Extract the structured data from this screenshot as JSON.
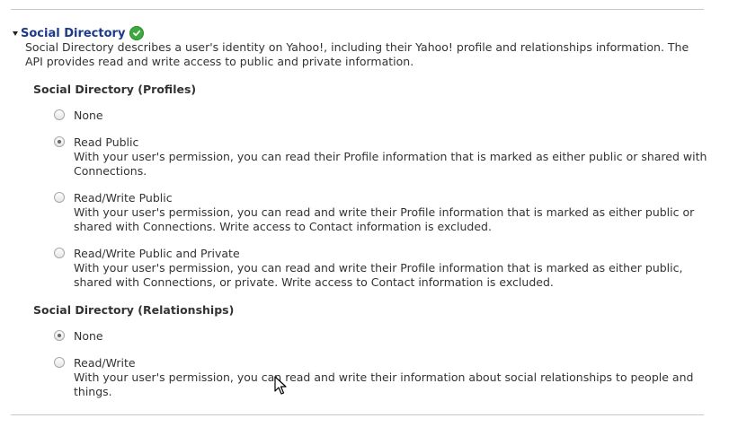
{
  "section": {
    "title": "Social Directory",
    "description": "Social Directory describes a user's identity on Yahoo!, including their Yahoo! profile and relationships information. The API provides read and write access to public and private information."
  },
  "profiles": {
    "heading": "Social Directory (Profiles)",
    "options": [
      {
        "label": "None",
        "desc": "",
        "checked": false
      },
      {
        "label": "Read Public",
        "desc": "With your user's permission, you can read their Profile information that is marked as either public or shared with Connections.",
        "checked": true
      },
      {
        "label": "Read/Write Public",
        "desc": "With your user's permission, you can read and write their Profile information that is marked as either public or shared with Connections. Write access to Contact information is excluded.",
        "checked": false
      },
      {
        "label": "Read/Write Public and Private",
        "desc": "With your user's permission, you can read and write their Profile information that is marked as either public, shared with Connections, or private. Write access to Contact information is excluded.",
        "checked": false
      }
    ]
  },
  "relationships": {
    "heading": "Social Directory (Relationships)",
    "options": [
      {
        "label": "None",
        "desc": "",
        "checked": true
      },
      {
        "label": "Read/Write",
        "desc": "With your user's permission, you can read and write their information about social relationships to people and things.",
        "checked": false
      }
    ]
  },
  "colors": {
    "title": "#1b3a8c",
    "check": "#3daa3d"
  },
  "icons": {
    "expand": "triangle-down-icon",
    "status": "checkmark-circle-icon",
    "cursor": "mouse-pointer-icon"
  }
}
